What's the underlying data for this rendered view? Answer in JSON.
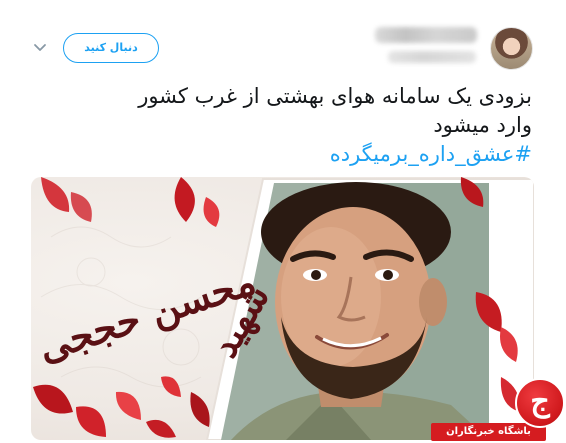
{
  "header": {
    "follow_label": "دنبال کنید"
  },
  "tweet": {
    "line1": "بزودی یک سامانه هوای بهشتی از غرب کشور",
    "line2": "وارد میشود",
    "hashtag": "#عشق_داره_برمیگرده"
  },
  "media": {
    "calligraphy_top": "شهید",
    "calligraphy_name": "محسن حججی"
  },
  "watermark": {
    "label": "باشگاه خبرنگاران",
    "logo_glyph": "ج"
  },
  "colors": {
    "accent": "#1da1f2",
    "text": "#14171a",
    "calligraphy": "#5a1014",
    "petal": "#d0222a",
    "watermark": "#d51c20"
  },
  "icons": [
    "chevron-down-icon",
    "avatar",
    "watermark-logo-icon"
  ]
}
